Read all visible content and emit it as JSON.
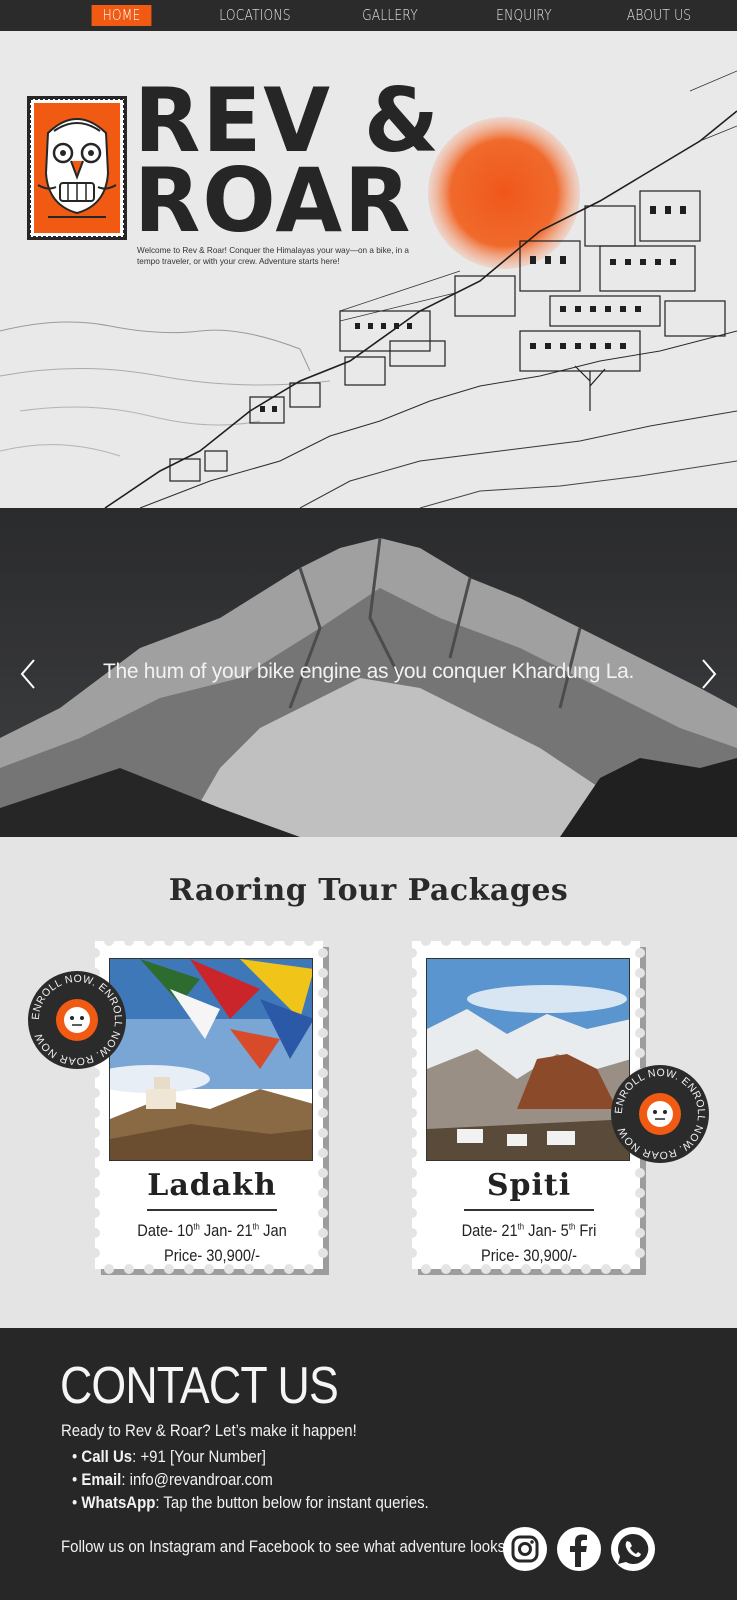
{
  "nav": {
    "items": [
      "HOME",
      "LOCATIONS",
      "GALLERY",
      "ENQUIRY",
      "ABOUT US"
    ],
    "active_index": 0,
    "accent": "#f05a13"
  },
  "hero": {
    "brand_line1": "REV &",
    "brand_line2": "ROAR",
    "tagline": "Welcome to Rev & Roar! Conquer the Himalayas your way—on a bike, in a tempo traveler, or with your crew. Adventure starts here!",
    "logo_icon": "tiger-mask-icon",
    "sun_color": "#f0571a"
  },
  "slider": {
    "caption": "The hum of your bike engine as you conquer Khardung La.",
    "prev_icon": "chevron-left-icon",
    "next_icon": "chevron-right-icon"
  },
  "packages": {
    "title": "Raoring Tour Packages",
    "items": [
      {
        "name": "Ladakh",
        "date_prefix": "Date- 10",
        "date_sup1": "th",
        "date_mid": " Jan- 21",
        "date_sup2": "th",
        "date_end": " Jan",
        "price": "Price- 30,900/-"
      },
      {
        "name": "Spiti",
        "date_prefix": "Date- 21",
        "date_sup1": "th",
        "date_mid": " Jan- 5",
        "date_sup2": "th",
        "date_end": " Fri",
        "price": "Price- 30,900/-"
      }
    ],
    "enroll_text": "ENROLL NOW. ENROLL NOW. ROAR NOW "
  },
  "contact": {
    "title": "CONTACT US",
    "intro": "Ready to Rev & Roar? Let’s make it happen!",
    "call_label": "Call Us",
    "call_value": ": +91 [Your Number]",
    "email_label": "Email",
    "email_value": ": info@revandroar.com",
    "whatsapp_label": "WhatsApp",
    "whatsapp_value": ": Tap the button below for instant queries.",
    "follow": "Follow us on Instagram and Facebook to see what adventure looks like!",
    "social_icons": [
      "instagram-icon",
      "facebook-icon",
      "whatsapp-icon"
    ]
  }
}
